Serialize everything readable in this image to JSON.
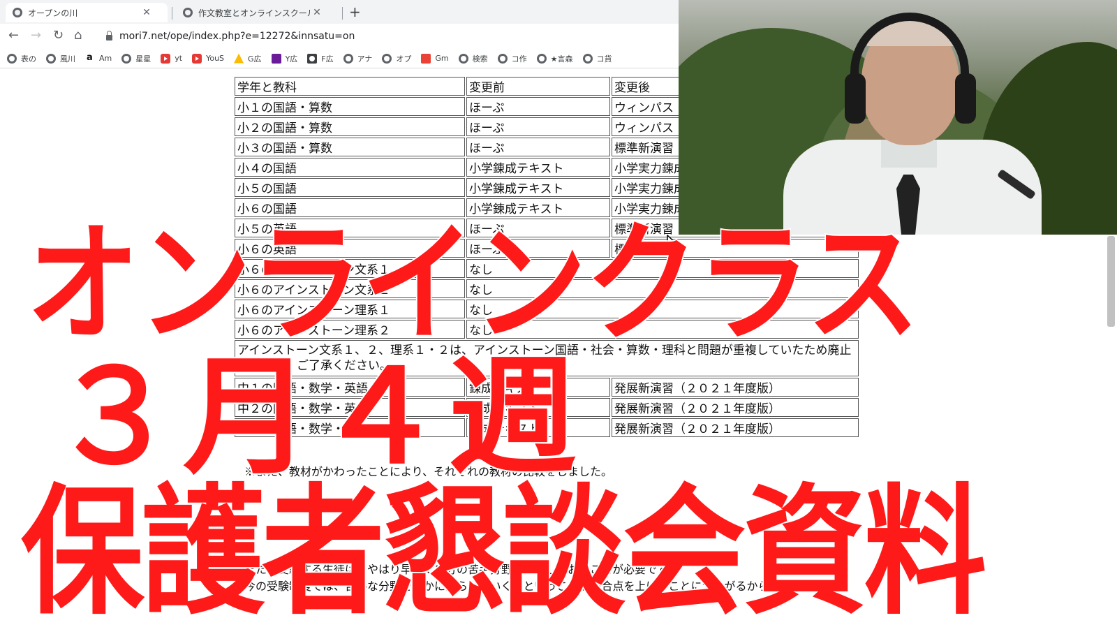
{
  "browser": {
    "tabs": [
      {
        "title": "オープンの川",
        "active": true
      },
      {
        "title": "作文教室とオンラインスクールの言葉",
        "active": false
      }
    ],
    "new_tab": "+",
    "url": "mori7.net/ope/index.php?e=12272&innsatu=on",
    "bookmarks": [
      "表の",
      "風川",
      "Am",
      "星星",
      "yt",
      "YouS",
      "G広",
      "Y広",
      "F広",
      "アナ",
      "オプ",
      "Gm",
      "検索",
      "コ作",
      "★言森",
      "コ貨"
    ]
  },
  "table": {
    "headers": [
      "学年と教科",
      "変更前",
      "変更後"
    ],
    "rows": [
      [
        "小１の国語・算数",
        "ほーぷ",
        "ウィンパス"
      ],
      [
        "小２の国語・算数",
        "ほーぷ",
        "ウィンパス"
      ],
      [
        "小３の国語・算数",
        "ほーぷ",
        "標準新演習"
      ],
      [
        "小４の国語",
        "小学錬成テキスト",
        "小学実力錬成"
      ],
      [
        "小５の国語",
        "小学錬成テキスト",
        "小学実力錬成"
      ],
      [
        "小６の国語",
        "小学錬成テキスト",
        "小学実力錬成"
      ],
      [
        "小５の英語",
        "ほーぷ",
        "標準新演習"
      ],
      [
        "小６の英語",
        "ほーぷ",
        "標準新演習"
      ],
      [
        "小６のアインストーン文系１",
        "なし",
        ""
      ],
      [
        "小６のアインストーン文系２",
        "なし",
        ""
      ],
      [
        "小６のアインストーン理系１",
        "なし",
        ""
      ],
      [
        "小６のアインストーン理系２",
        "なし",
        ""
      ]
    ],
    "note": "アインストーン文系１、２、理系１・２は、アインストーン国語・社会・算数・理科と問題が重複していたため廃止しました。ご了承ください。",
    "rows2": [
      [
        "中１の国語・数学・英語",
        "錬成テキスト",
        "発展新演習（２０２１年度版）"
      ],
      [
        "中２の国語・数学・英語",
        "錬成テキスト",
        "発展新演習（２０２１年度版）"
      ],
      [
        "中３の国語・数学・英語",
        "錬成テキスト",
        "発展新演習（２０２１年度版）"
      ]
    ]
  },
  "paragraphs": [
    "※また、教材がかわったことにより、それぞれの教材の比較をしました。",
    "また、受験する生徒は、やはり早めに自分の苦手分野を把握しておくことが必要です。",
    "今の受験制度では、苦手な分野をいかに減らしていくかということが総合点を上げることにつながるからで"
  ],
  "overlay": {
    "line1": "オンラインクラス",
    "line2": "３月４週",
    "line3": "保護者懇談会資料"
  },
  "colors": {
    "overlay_text": "#ff1a1a",
    "overlay_stroke": "#ffffff"
  }
}
